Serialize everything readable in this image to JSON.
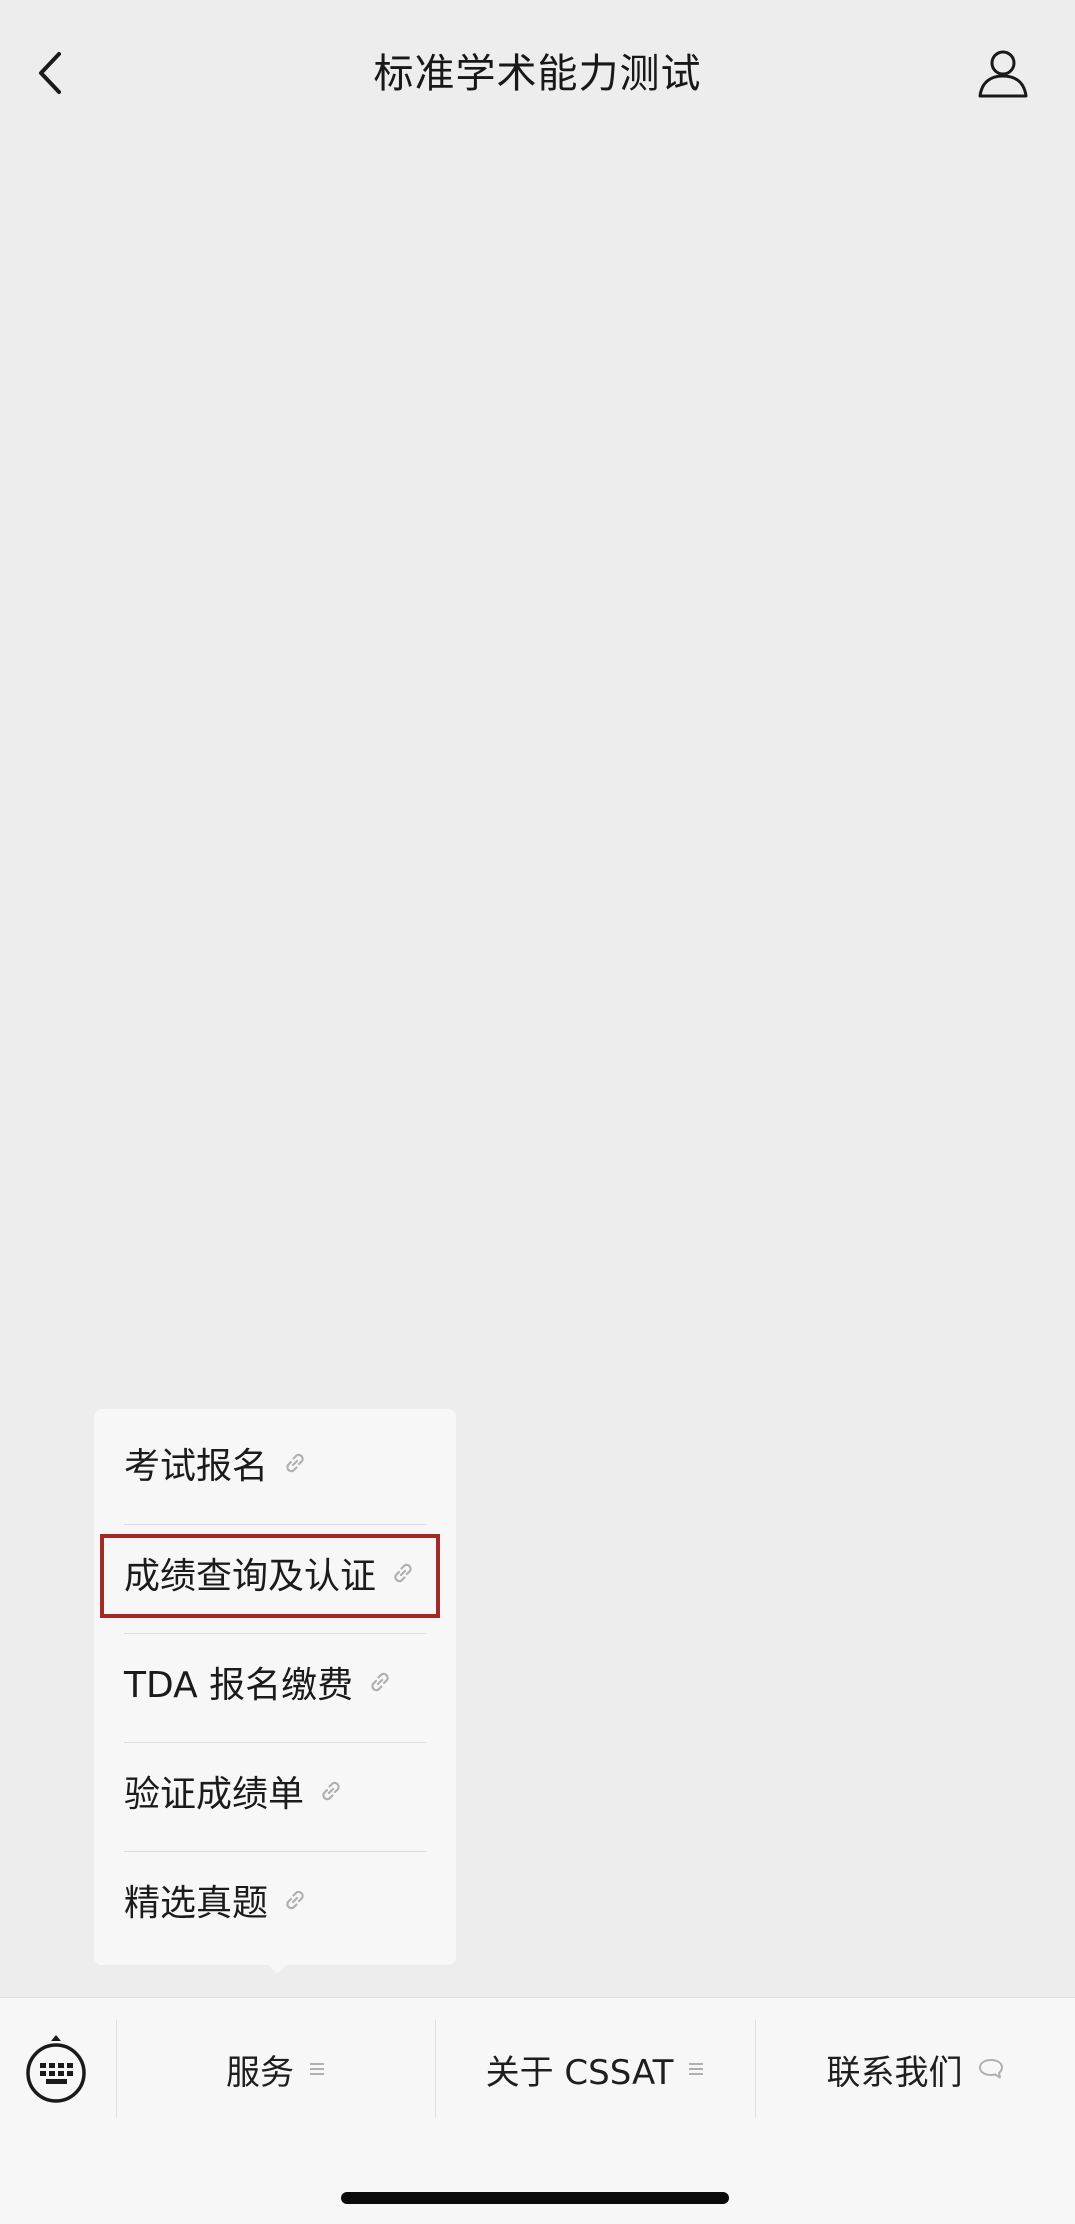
{
  "header": {
    "title": "标准学术能力测试",
    "back_icon": "chevron-left-icon",
    "profile_icon": "person-outline-icon"
  },
  "popup_menu": {
    "items": [
      {
        "label": "考试报名",
        "icon": "link-icon"
      },
      {
        "label": "成绩查询及认证",
        "icon": "link-icon",
        "highlighted": true
      },
      {
        "label": "TDA 报名缴费",
        "icon": "link-icon"
      },
      {
        "label": "验证成绩单",
        "icon": "link-icon"
      },
      {
        "label": "精选真题",
        "icon": "link-icon"
      }
    ]
  },
  "bottom_bar": {
    "keyboard_icon": "keyboard-icon",
    "tabs": [
      {
        "label": "服务",
        "icon": "menu-lines-icon"
      },
      {
        "label": "关于 CSSAT",
        "icon": "menu-lines-icon"
      },
      {
        "label": "联系我们",
        "icon": "speech-bubble-icon"
      }
    ]
  },
  "colors": {
    "background": "#ededed",
    "menu_background": "#f7f7f7",
    "highlight_border": "#a32a24",
    "text": "#1b1b1b",
    "icon_muted": "#b0b0b0"
  }
}
